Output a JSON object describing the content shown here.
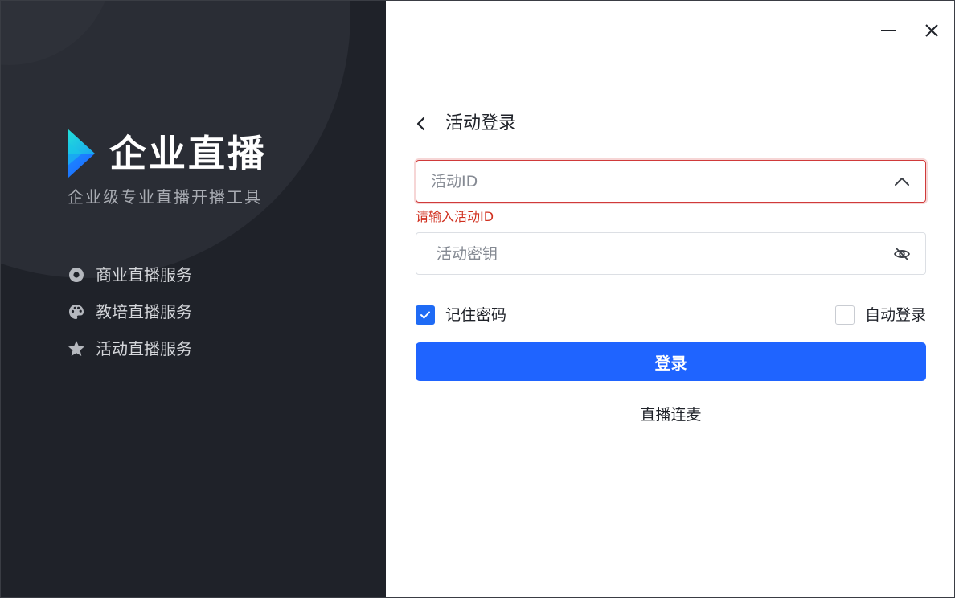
{
  "brand": {
    "title": "企业直播",
    "subtitle": "企业级专业直播开播工具",
    "logo_icon": "play-logo-icon",
    "colors": {
      "logo_top": "#1fd6e0",
      "logo_bottom": "#1f6bff",
      "panel_bg": "#1f2229"
    }
  },
  "features": [
    {
      "icon": "record-icon",
      "label": "商业直播服务"
    },
    {
      "icon": "palette-icon",
      "label": "教培直播服务"
    },
    {
      "icon": "star-icon",
      "label": "活动直播服务"
    }
  ],
  "window_controls": {
    "minimize_icon": "minimize-icon",
    "close_icon": "close-icon"
  },
  "login": {
    "title": "活动登录",
    "back_icon": "chevron-left-icon",
    "activity_id": {
      "value": "",
      "placeholder": "活动ID",
      "suffix_icon": "chevron-up-icon",
      "error": "请输入活动ID"
    },
    "activity_key": {
      "value": "",
      "placeholder": "活动密钥",
      "suffix_icon": "eye-off-icon"
    },
    "remember_password": {
      "label": "记住密码",
      "checked": true
    },
    "auto_login": {
      "label": "自动登录",
      "checked": false
    },
    "submit_label": "登录",
    "live_connect_label": "直播连麦",
    "colors": {
      "primary": "#1f64ff",
      "error": "#d0301f"
    }
  }
}
